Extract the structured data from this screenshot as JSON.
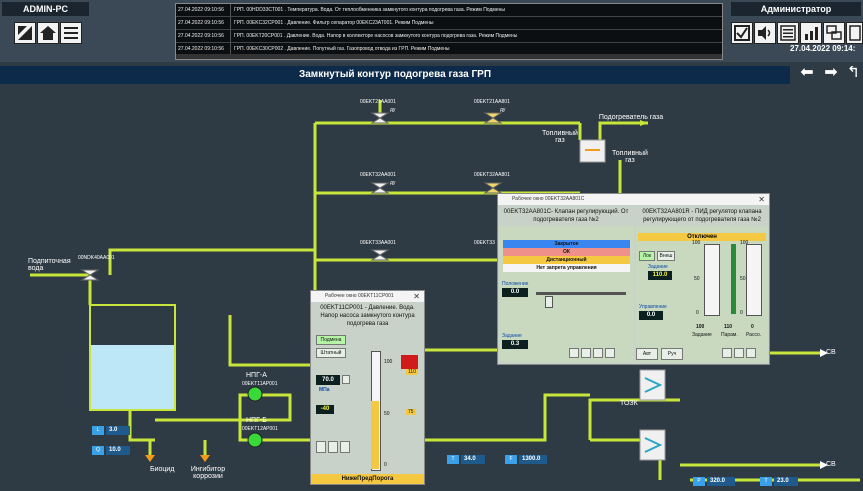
{
  "top": {
    "station": "ADMIN-PC",
    "user": "Администратор",
    "datetime": "27.04.2022 09:14:",
    "log": [
      {
        "time": "27.04.2022 09:10:56",
        "msg": "ГРП. 00НDD33СТ001 . Температура. Вода. От теплообменника замкнутого контура подогрева газа. Режим Подмены"
      },
      {
        "time": "27.04.2022 09:10:56",
        "msg": "ГРП. 00EKС32СР001 . Давление. Фильтр сепаратор 00EKС23АТ001. Режим Подмены"
      },
      {
        "time": "27.04.2022 09:10:56",
        "msg": "ГРП. 00EKТ20СР001 . Давление. Вода. Напор в коллекторе насосов замкнутого контура подогрева газа. Режим Подмены"
      },
      {
        "time": "27.04.2022 09:10:56",
        "msg": "ГРП. 00EKС30СР002 . Давление. Попутный газ. Газопровод отвода из ГРП. Режим Подмены"
      }
    ]
  },
  "title": "Замкнутый контур подогрева газа ГРП",
  "diagram": {
    "valve_labels": [
      "00EKT21AA001",
      "00EKT21AA801",
      "00EKT32AA001",
      "00EKT32AA801",
      "00EKT33AA001",
      "00EKT33",
      "00NDK40AA001"
    ],
    "du": "ду",
    "heater": "Подогреватель газа",
    "fuel_gas": "Топливный газ",
    "fuel_gas2": "Топливный газ",
    "makeup_in": "Подпиточная вода",
    "pump_a": "НПГ-А",
    "pump_a_tag": "00EKT11AP001",
    "pump_b": "НПГ-Б",
    "pump_b_tag": "00EKT12AP001",
    "biocide": "Биоцид",
    "inhibitor": "Ингибитор коррозии",
    "tozk": "ТОЗК",
    "sv1": "СВ",
    "sv2": "СВ",
    "level_l": "3.0",
    "level_q": "10.0",
    "tag_l": "L",
    "tag_q": "Q",
    "t1": "34.0",
    "f1": "1300.0",
    "p1": "320.0",
    "t2": "23.0",
    "tag_t": "T",
    "tag_f": "F",
    "tag_p": "P"
  },
  "pump_window": {
    "title": "Рабочее окно 00EKT11CP001",
    "head": "00EKT11CP001 - Давление. Вода. Напор насоса замкнутого контура подогрева газа",
    "btn_mode": "Подмена",
    "btn_normal": "Штатный",
    "value": "70.0",
    "unit": "МПа",
    "limit": "-40",
    "scale_top": "100",
    "scale_mid": "50",
    "scale_bot": "0",
    "hh": "110",
    "hi": "75",
    "footer": "НижеПредПорога"
  },
  "valve_window": {
    "title": "Рабочее окно 00EKT32AA801C",
    "head_left": "00EKT32AA801C- Клапан регулирующий. От подогревателя газа №2",
    "head_right": "00EKT32AA801R - ПИД регулятор клапана регулирующего от подогревателя газа №2",
    "status_closed": "Закрытое",
    "status_ok": "ОК",
    "status_remote": "Дистанционный",
    "status_noctrl": "Нет запрета управления",
    "pos_label": "Положение",
    "pos_value": "0.0",
    "set_label": "Задание",
    "set_value": "0.3",
    "off_label": "Отключен",
    "btn_loc": "Лок",
    "btn_ext": "Внеш",
    "target_label": "Задание",
    "target_value": "110.0",
    "ctrl_label": "Управление",
    "ctrl_value": "0.0",
    "zadan": "Задание",
    "param": "Парам.",
    "rass": "Рассо.",
    "v_zad": "100",
    "v_par": "110",
    "v_ras": "0",
    "btn_auto": "Авт",
    "btn_manual": "Руч",
    "scale100": "100",
    "scale50": "50",
    "scale0": "0"
  }
}
